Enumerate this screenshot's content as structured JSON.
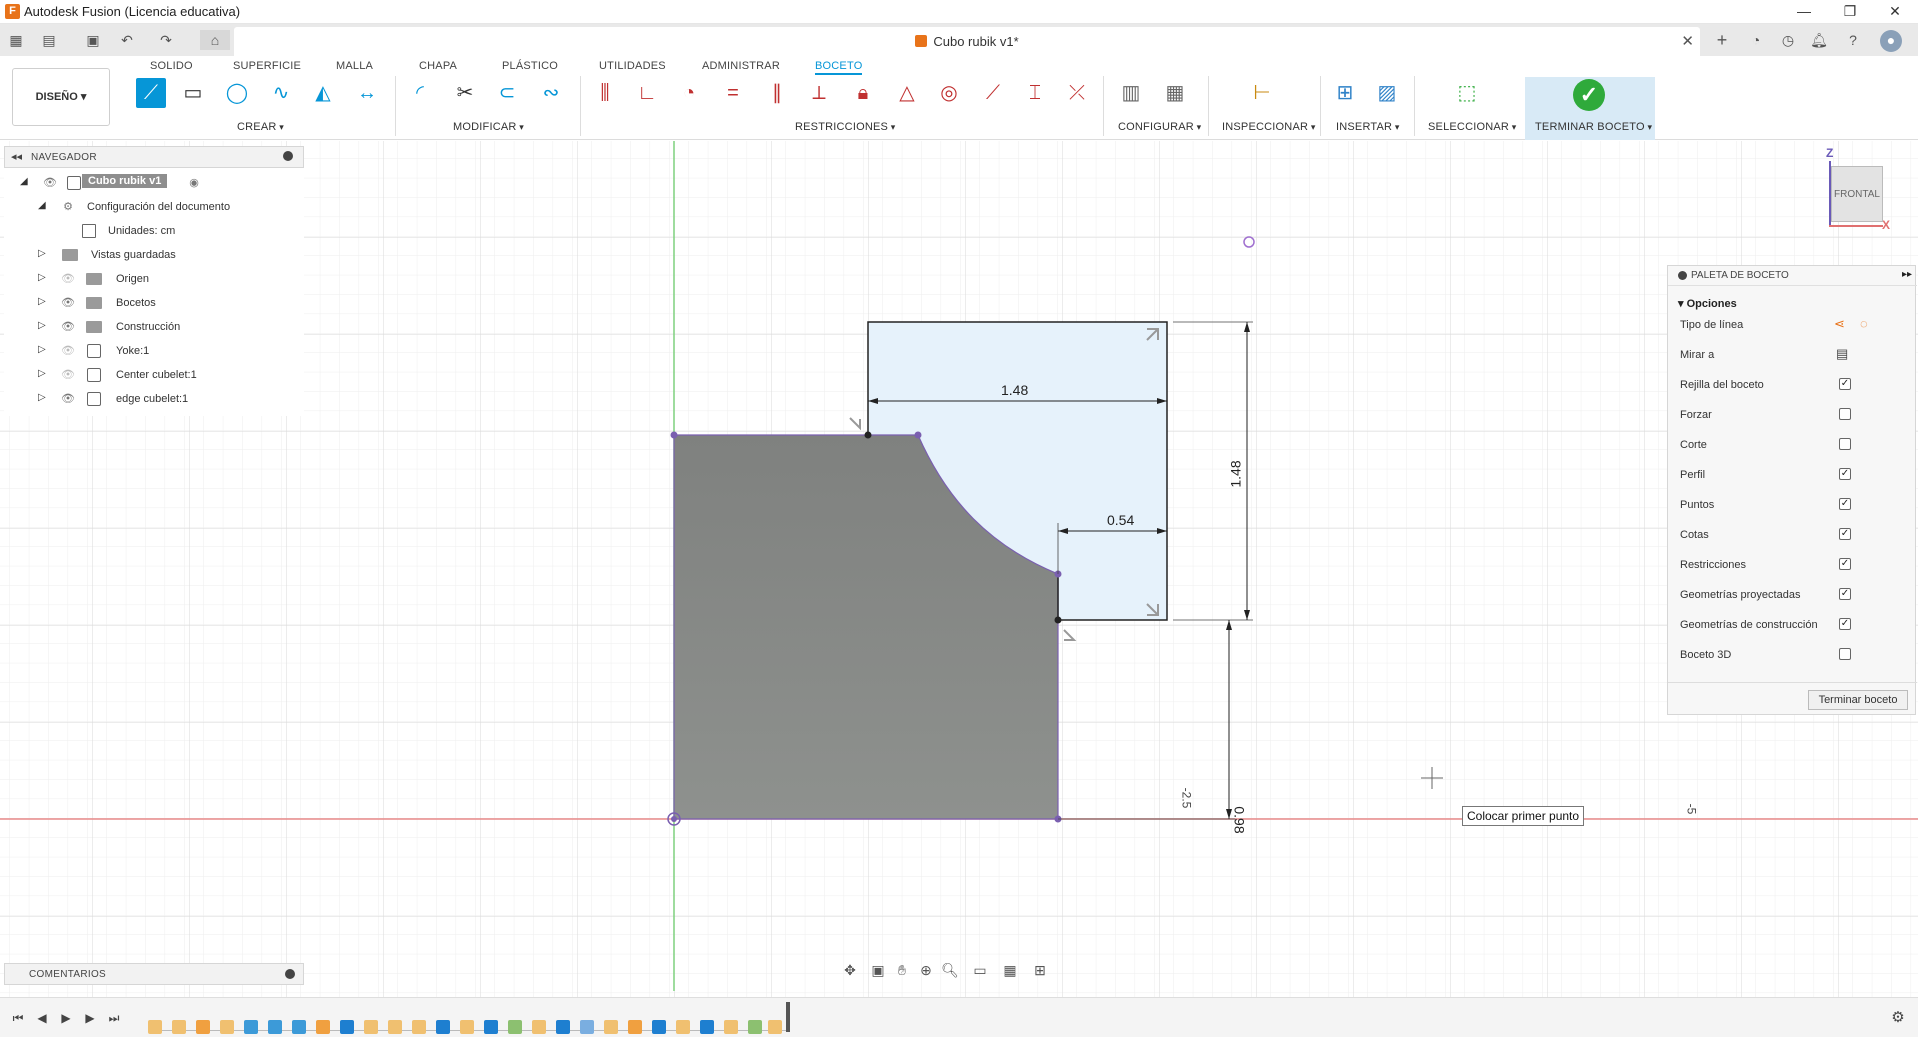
{
  "window": {
    "title": "Autodesk Fusion (Licencia educativa)",
    "minimize": "—",
    "restore": "❐",
    "close": "✕"
  },
  "document_tab": {
    "title": "Cubo rubik v1*",
    "close": "✕"
  },
  "ribbon": {
    "tabs": [
      "SOLIDO",
      "SUPERFICIE",
      "MALLA",
      "CHAPA",
      "PLÁSTICO",
      "UTILIDADES",
      "ADMINISTRAR",
      "BOCETO"
    ],
    "active_tab": "BOCETO",
    "workspace_button": "DISEÑO ▾",
    "groups": {
      "crear": "CREAR",
      "modificar": "MODIFICAR",
      "restricciones": "RESTRICCIONES",
      "configurar": "CONFIGURAR",
      "inspeccionar": "INSPECCIONAR",
      "insertar": "INSERTAR",
      "seleccionar": "SELECCIONAR",
      "terminar": "TERMINAR BOCETO"
    }
  },
  "browser": {
    "title": "NAVEGADOR",
    "root": "Cubo rubik v1",
    "items": [
      {
        "label": "Configuración del documento"
      },
      {
        "label": "Unidades: cm"
      },
      {
        "label": "Vistas guardadas"
      },
      {
        "label": "Origen"
      },
      {
        "label": "Bocetos"
      },
      {
        "label": "Construcción"
      },
      {
        "label": "Yoke:1"
      },
      {
        "label": "Center cubelet:1"
      },
      {
        "label": "edge cubelet:1"
      }
    ]
  },
  "comments": {
    "title": "COMENTARIOS"
  },
  "sketch_palette": {
    "title": "PALETA DE BOCETO",
    "section": "Opciones",
    "rows": [
      {
        "label": "Tipo de línea"
      },
      {
        "label": "Mirar a"
      },
      {
        "label": "Rejilla del boceto",
        "checked": "✓"
      },
      {
        "label": "Forzar",
        "checked": ""
      },
      {
        "label": "Corte",
        "checked": ""
      },
      {
        "label": "Perfil",
        "checked": "✓"
      },
      {
        "label": "Puntos",
        "checked": "✓"
      },
      {
        "label": "Cotas",
        "checked": "✓"
      },
      {
        "label": "Restricciones",
        "checked": "✓"
      },
      {
        "label": "Geometrías proyectadas",
        "checked": "✓"
      },
      {
        "label": "Geometrías de construcción",
        "checked": "✓"
      },
      {
        "label": "Boceto 3D",
        "checked": ""
      }
    ],
    "finish_button": "Terminar boceto"
  },
  "viewcube": {
    "face": "FRONTAL",
    "axis_z": "Z",
    "axis_x": "X"
  },
  "dimensions": {
    "top_width": "1.48",
    "right_height": "1.48",
    "inner_width": "0.54",
    "bottom_height": "0.98",
    "axis_label_a": "-2.5",
    "axis_label_b": "-5"
  },
  "tooltip": "Colocar primer punto",
  "colors": {
    "accent": "#0696d7",
    "profile_fill": "#8a8c8a",
    "sketch_line": "#7a5fb0",
    "x_axis": "#e88a8a",
    "z_axis": "#7fd07f",
    "finish_green": "#2faa3b"
  }
}
